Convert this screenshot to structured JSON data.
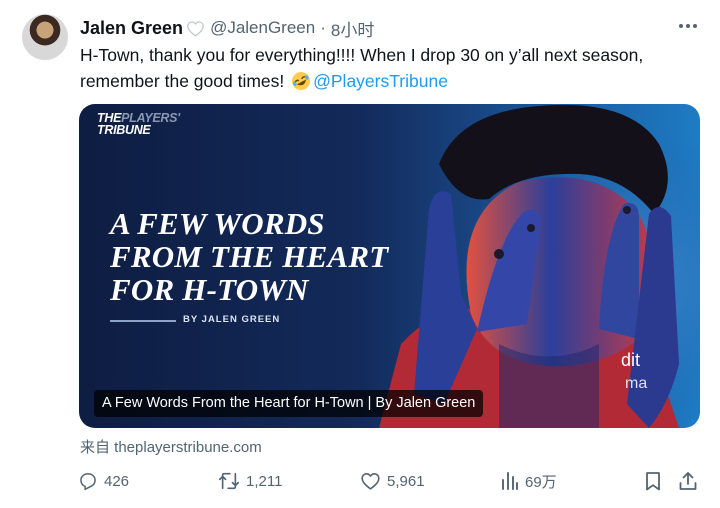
{
  "author": {
    "display_name": "Jalen Green",
    "handle": "@JalenGreen",
    "separator": "·",
    "timestamp": "8小时"
  },
  "tweet": {
    "text_part1": "H-Town, thank you for everything!!!! When I drop 30 on y’all next season, remember the good times! ",
    "emoji": "rolling-on-floor-laughing",
    "mention": "@PlayersTribune"
  },
  "card": {
    "brand_the": "THE",
    "brand_players": "PLAYERS'",
    "brand_tribune": "TRIBUNE",
    "headline": "A FEW WORDS FROM THE HEART FOR H-TOWN",
    "byline": "BY JALEN GREEN",
    "caption": "A Few Words From the Heart for H-Town | By Jalen Green"
  },
  "source": "来自 theplayerstribune.com",
  "actions": {
    "replies": "426",
    "retweets": "1,211",
    "likes": "5,961",
    "views": "69万"
  },
  "icons": [
    "heart-outline-icon",
    "more-icon",
    "reply-icon",
    "retweet-icon",
    "like-icon",
    "views-icon",
    "bookmark-icon",
    "share-icon"
  ],
  "colors": {
    "accent": "#1d9bf0",
    "muted": "#536471",
    "text": "#0f1419"
  }
}
